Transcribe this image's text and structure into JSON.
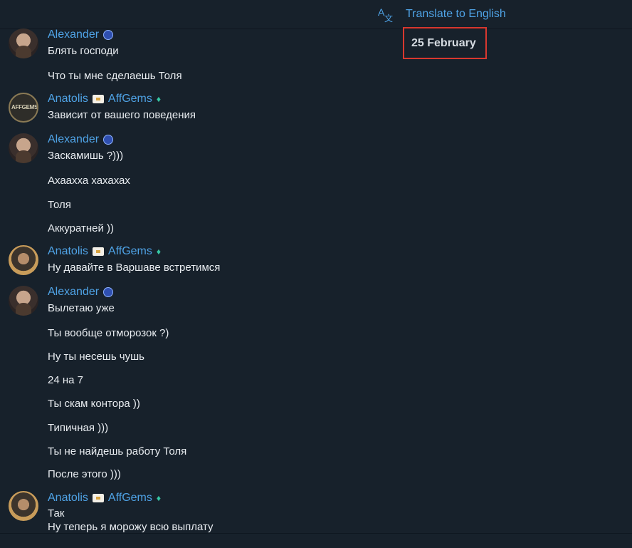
{
  "header": {
    "translate_label": "Translate to English",
    "translate_icon": "translate-icon"
  },
  "date_divider": "25 February",
  "messages": [
    {
      "sender": "Alexander",
      "avatar": "alexander",
      "lines": [
        "Блять господи",
        "Что ты мне сделаешь Толя"
      ]
    },
    {
      "sender": "Anatolis",
      "tag": "AffGems",
      "avatar": "affgems-logo",
      "lines": [
        "Зависит от вашего поведения"
      ]
    },
    {
      "sender": "Alexander",
      "avatar": "alexander",
      "lines": [
        "Заскамишь ?)))",
        "Ахаахха хахахах",
        "Толя",
        "Аккуратней ))"
      ]
    },
    {
      "sender": "Anatolis",
      "tag": "AffGems",
      "avatar": "anatolis",
      "lines": [
        "Ну давайте в Варшаве встретимся"
      ]
    },
    {
      "sender": "Alexander",
      "avatar": "alexander",
      "lines": [
        "Вылетаю уже",
        "Ты вообще отморозок ?)",
        "Ну ты несешь чушь",
        "24 на 7",
        "Ты скам контора ))",
        "Типичная )))",
        "Ты не найдешь работу Толя",
        "После этого )))"
      ]
    },
    {
      "sender": "Anatolis",
      "tag": "AffGems",
      "avatar": "anatolis",
      "lines": [
        "Так",
        "Ну теперь я морожу всю выплату"
      ]
    }
  ]
}
